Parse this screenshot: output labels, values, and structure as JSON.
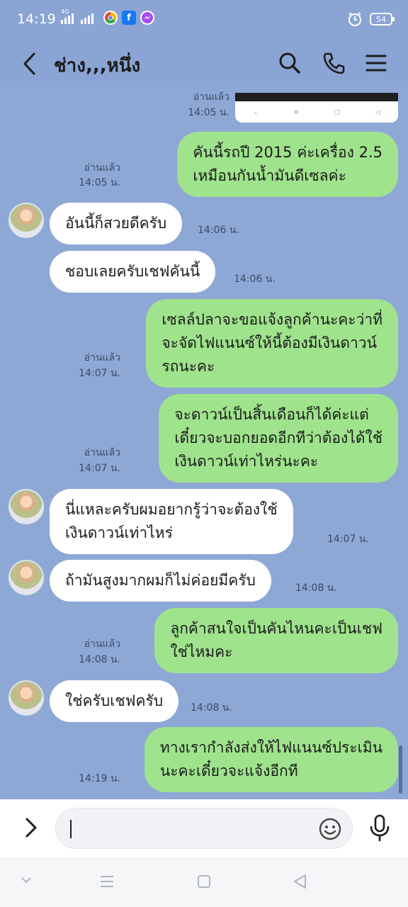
{
  "status_bar": {
    "time": "14:19",
    "network_label": "4G",
    "battery": "54",
    "apps": [
      {
        "icon": "chrome-icon",
        "color": "#e6a21a"
      },
      {
        "icon": "facebook-icon",
        "color": "#1877f2"
      },
      {
        "icon": "messenger-icon",
        "color": "#a64bf4"
      }
    ]
  },
  "header": {
    "title": "ช่าง,,,หนึ่ง",
    "back_icon": "back-arrow-icon",
    "actions": [
      "search-icon",
      "phone-icon",
      "menu-icon"
    ]
  },
  "chat": {
    "top_image_read": "อ่านแล้ว",
    "top_image_time": "14:05 น.",
    "messages": [
      {
        "dir": "out",
        "text": "คันนี้รถปี 2015 ค่ะเครื่อง 2.5\nเหมือนกันน้ำมันดีเซลค่ะ",
        "read": "อ่านแล้ว",
        "time": "14:05 น."
      },
      {
        "dir": "in",
        "text": "อันนี้ก็สวยดีครับ",
        "time": "14:06 น.",
        "avatar": true
      },
      {
        "dir": "in",
        "text": "ชอบเลยครับเชฟคันนี้",
        "time": "14:06 น.",
        "avatar": false
      },
      {
        "dir": "out",
        "text": "เซลล์ปลาจะขอแจ้งลูกค้านะคะว่าที่\nจะจัดไฟแนนซ์ให้นี้ต้องมีเงินดาวน์\nรถนะคะ",
        "read": "อ่านแล้ว",
        "time": "14:07 น."
      },
      {
        "dir": "out",
        "text": "จะดาวน์เป็นสิ้นเดือนก็ได้ค่ะแต่\nเดี๋ยวจะบอกยอดอีกทีว่าต้องได้ใช้\nเงินดาวน์เท่าไหร่นะคะ",
        "read": "อ่านแล้ว",
        "time": "14:07 น."
      },
      {
        "dir": "in",
        "text": "นี่แหละครับผมอยากรู้ว่าจะต้องใช้\nเงินดาวน์เท่าไหร่",
        "time": "14:07 น.",
        "avatar": true
      },
      {
        "dir": "in",
        "text": "ถ้ามันสูงมากผมก็ไม่ค่อยมีครับ",
        "time": "14:08 น.",
        "avatar": true
      },
      {
        "dir": "out",
        "text": "ลูกค้าสนใจเป็นคันไหนคะเป็นเชฟ\nใช่ไหมคะ",
        "read": "อ่านแล้ว",
        "time": "14:08 น."
      },
      {
        "dir": "in",
        "text": "ใช่ครับเชฟครับ",
        "time": "14:08 น.",
        "avatar": true
      },
      {
        "dir": "out",
        "text": "ทางเรากำลังส่งให้ไฟแนนซ์ประเมิน\nนะคะเดี๋ยวจะแจ้งอีกที",
        "read": "",
        "time": "14:19 น."
      }
    ]
  },
  "input": {
    "value": "",
    "icons": [
      "expand-icon",
      "emoji-icon",
      "microphone-icon"
    ]
  },
  "system_nav": [
    "collapse-icon",
    "recents-icon",
    "home-icon",
    "back-triangle-icon"
  ]
}
